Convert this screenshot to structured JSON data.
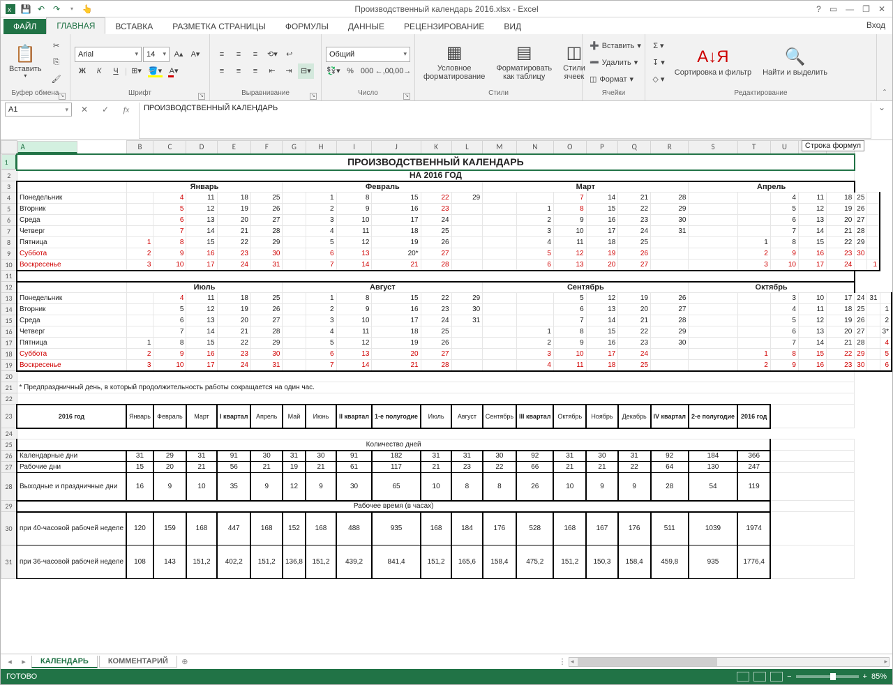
{
  "title": "Производственный календарь 2016.xlsx - Excel",
  "login": "Вход",
  "tabs": {
    "file": "ФАЙЛ",
    "list": [
      "ГЛАВНАЯ",
      "ВСТАВКА",
      "РАЗМЕТКА СТРАНИЦЫ",
      "ФОРМУЛЫ",
      "ДАННЫЕ",
      "РЕЦЕНЗИРОВАНИЕ",
      "ВИД"
    ],
    "active": 0
  },
  "ribbon": {
    "clipboard": {
      "label": "Буфер обмена",
      "paste": "Вставить"
    },
    "font": {
      "label": "Шрифт",
      "name": "Arial",
      "size": "14"
    },
    "align": {
      "label": "Выравнивание"
    },
    "number": {
      "label": "Число",
      "format": "Общий"
    },
    "styles": {
      "label": "Стили",
      "cond": "Условное форматирование",
      "fmt": "Форматировать как таблицу",
      "cell": "Стили ячеек"
    },
    "cells": {
      "label": "Ячейки",
      "ins": "Вставить",
      "del": "Удалить",
      "fmt": "Формат"
    },
    "edit": {
      "label": "Редактирование",
      "sort": "Сортировка и фильтр",
      "find": "Найти и выделить"
    }
  },
  "namebox": "A1",
  "formula": "ПРОИЗВОДСТВЕННЫЙ КАЛЕНДАРЬ",
  "tooltip": "Строка формул",
  "cols": [
    "A",
    "B",
    "C",
    "D",
    "E",
    "F",
    "G",
    "H",
    "I",
    "J",
    "K",
    "L",
    "M",
    "N",
    "O",
    "P",
    "Q",
    "R",
    "S",
    "T",
    "U",
    "V",
    "W"
  ],
  "sheet": {
    "title1": "ПРОИЗВОДСТВЕННЫЙ КАЛЕНДАРЬ",
    "title2": "НА 2016 ГОД",
    "months1": [
      "Январь",
      "Февраль",
      "Март",
      "Апрель"
    ],
    "months2": [
      "Июль",
      "Август",
      "Сентябрь",
      "Октябрь"
    ],
    "days": [
      "Понедельник",
      "Вторник",
      "Среда",
      "Четверг",
      "Пятница",
      "Суббота",
      "Воскресенье"
    ],
    "block1": {
      "jan": [
        [
          "",
          "4",
          "11",
          "18",
          "25"
        ],
        [
          "",
          "5",
          "12",
          "19",
          "26"
        ],
        [
          "",
          "6",
          "13",
          "20",
          "27"
        ],
        [
          "",
          "7",
          "14",
          "21",
          "28"
        ],
        [
          "1",
          "8",
          "15",
          "22",
          "29"
        ],
        [
          "2",
          "9",
          "16",
          "23",
          "30"
        ],
        [
          "3",
          "10",
          "17",
          "24",
          "31"
        ]
      ],
      "jan_red": [
        [
          0,
          1,
          0,
          0,
          0
        ],
        [
          0,
          1,
          0,
          0,
          0
        ],
        [
          0,
          1,
          0,
          0,
          0
        ],
        [
          0,
          1,
          0,
          0,
          0
        ],
        [
          1,
          1,
          0,
          0,
          0
        ],
        [
          1,
          1,
          1,
          1,
          1
        ],
        [
          1,
          1,
          1,
          1,
          1
        ]
      ],
      "feb": [
        [
          "1",
          "8",
          "15",
          "22",
          "29"
        ],
        [
          "2",
          "9",
          "16",
          "23",
          ""
        ],
        [
          "3",
          "10",
          "17",
          "24",
          ""
        ],
        [
          "4",
          "11",
          "18",
          "25",
          ""
        ],
        [
          "5",
          "12",
          "19",
          "26",
          ""
        ],
        [
          "6",
          "13",
          "20*",
          "27",
          ""
        ],
        [
          "7",
          "14",
          "21",
          "28",
          ""
        ]
      ],
      "feb_red": [
        [
          0,
          0,
          0,
          1,
          0
        ],
        [
          0,
          0,
          0,
          1,
          0
        ],
        [
          0,
          0,
          0,
          0,
          0
        ],
        [
          0,
          0,
          0,
          0,
          0
        ],
        [
          0,
          0,
          0,
          0,
          0
        ],
        [
          1,
          1,
          0,
          1,
          0
        ],
        [
          1,
          1,
          1,
          1,
          0
        ]
      ],
      "mar": [
        [
          "",
          "7",
          "14",
          "21",
          "28"
        ],
        [
          "1",
          "8",
          "15",
          "22",
          "29"
        ],
        [
          "2",
          "9",
          "16",
          "23",
          "30"
        ],
        [
          "3",
          "10",
          "17",
          "24",
          "31"
        ],
        [
          "4",
          "11",
          "18",
          "25",
          ""
        ],
        [
          "5",
          "12",
          "19",
          "26",
          ""
        ],
        [
          "6",
          "13",
          "20",
          "27",
          ""
        ]
      ],
      "mar_red": [
        [
          0,
          1,
          0,
          0,
          0
        ],
        [
          0,
          1,
          0,
          0,
          0
        ],
        [
          0,
          0,
          0,
          0,
          0
        ],
        [
          0,
          0,
          0,
          0,
          0
        ],
        [
          0,
          0,
          0,
          0,
          0
        ],
        [
          1,
          1,
          1,
          1,
          0
        ],
        [
          1,
          1,
          1,
          1,
          0
        ]
      ],
      "apr": [
        [
          "",
          "4",
          "11",
          "18",
          "25",
          ""
        ],
        [
          "",
          "5",
          "12",
          "19",
          "26",
          ""
        ],
        [
          "",
          "6",
          "13",
          "20",
          "27",
          ""
        ],
        [
          "",
          "7",
          "14",
          "21",
          "28",
          ""
        ],
        [
          "1",
          "8",
          "15",
          "22",
          "29",
          ""
        ],
        [
          "2",
          "9",
          "16",
          "23",
          "30",
          ""
        ],
        [
          "3",
          "10",
          "17",
          "24",
          "",
          "1"
        ]
      ],
      "apr_red": [
        [
          0,
          0,
          0,
          0,
          0,
          0
        ],
        [
          0,
          0,
          0,
          0,
          0,
          0
        ],
        [
          0,
          0,
          0,
          0,
          0,
          0
        ],
        [
          0,
          0,
          0,
          0,
          0,
          0
        ],
        [
          0,
          0,
          0,
          0,
          0,
          0
        ],
        [
          1,
          1,
          1,
          1,
          1,
          0
        ],
        [
          1,
          1,
          1,
          1,
          0,
          1
        ]
      ]
    },
    "block2": {
      "jul": [
        [
          "",
          "4",
          "11",
          "18",
          "25"
        ],
        [
          "",
          "5",
          "12",
          "19",
          "26"
        ],
        [
          "",
          "6",
          "13",
          "20",
          "27"
        ],
        [
          "",
          "7",
          "14",
          "21",
          "28"
        ],
        [
          "1",
          "8",
          "15",
          "22",
          "29"
        ],
        [
          "2",
          "9",
          "16",
          "23",
          "30"
        ],
        [
          "3",
          "10",
          "17",
          "24",
          "31"
        ]
      ],
      "jul_red": [
        [
          0,
          1,
          0,
          0,
          0
        ],
        [
          0,
          0,
          0,
          0,
          0
        ],
        [
          0,
          0,
          0,
          0,
          0
        ],
        [
          0,
          0,
          0,
          0,
          0
        ],
        [
          0,
          0,
          0,
          0,
          0
        ],
        [
          1,
          1,
          1,
          1,
          1
        ],
        [
          1,
          1,
          1,
          1,
          1
        ]
      ],
      "aug": [
        [
          "1",
          "8",
          "15",
          "22",
          "29"
        ],
        [
          "2",
          "9",
          "16",
          "23",
          "30"
        ],
        [
          "3",
          "10",
          "17",
          "24",
          "31"
        ],
        [
          "4",
          "11",
          "18",
          "25",
          ""
        ],
        [
          "5",
          "12",
          "19",
          "26",
          ""
        ],
        [
          "6",
          "13",
          "20",
          "27",
          ""
        ],
        [
          "7",
          "14",
          "21",
          "28",
          ""
        ]
      ],
      "aug_red": [
        [
          0,
          0,
          0,
          0,
          0
        ],
        [
          0,
          0,
          0,
          0,
          0
        ],
        [
          0,
          0,
          0,
          0,
          0
        ],
        [
          0,
          0,
          0,
          0,
          0
        ],
        [
          0,
          0,
          0,
          0,
          0
        ],
        [
          1,
          1,
          1,
          1,
          0
        ],
        [
          1,
          1,
          1,
          1,
          0
        ]
      ],
      "sep": [
        [
          "",
          "5",
          "12",
          "19",
          "26"
        ],
        [
          "",
          "6",
          "13",
          "20",
          "27"
        ],
        [
          "",
          "7",
          "14",
          "21",
          "28"
        ],
        [
          "1",
          "8",
          "15",
          "22",
          "29"
        ],
        [
          "2",
          "9",
          "16",
          "23",
          "30"
        ],
        [
          "3",
          "10",
          "17",
          "24",
          ""
        ],
        [
          "4",
          "11",
          "18",
          "25",
          ""
        ]
      ],
      "sep_red": [
        [
          0,
          0,
          0,
          0,
          0
        ],
        [
          0,
          0,
          0,
          0,
          0
        ],
        [
          0,
          0,
          0,
          0,
          0
        ],
        [
          0,
          0,
          0,
          0,
          0
        ],
        [
          0,
          0,
          0,
          0,
          0
        ],
        [
          1,
          1,
          1,
          1,
          0
        ],
        [
          1,
          1,
          1,
          1,
          0
        ]
      ],
      "oct": [
        [
          "",
          "3",
          "10",
          "17",
          "24",
          "31",
          ""
        ],
        [
          "",
          "4",
          "11",
          "18",
          "25",
          "",
          "1"
        ],
        [
          "",
          "5",
          "12",
          "19",
          "26",
          "",
          "2"
        ],
        [
          "",
          "6",
          "13",
          "20",
          "27",
          "",
          "3*"
        ],
        [
          "",
          "7",
          "14",
          "21",
          "28",
          "",
          "4"
        ],
        [
          "1",
          "8",
          "15",
          "22",
          "29",
          "",
          "5"
        ],
        [
          "2",
          "9",
          "16",
          "23",
          "30",
          "",
          "6"
        ]
      ],
      "oct_red": [
        [
          0,
          0,
          0,
          0,
          0,
          0,
          0
        ],
        [
          0,
          0,
          0,
          0,
          0,
          0,
          0
        ],
        [
          0,
          0,
          0,
          0,
          0,
          0,
          0
        ],
        [
          0,
          0,
          0,
          0,
          0,
          0,
          0
        ],
        [
          0,
          0,
          0,
          0,
          0,
          0,
          1
        ],
        [
          1,
          1,
          1,
          1,
          1,
          0,
          1
        ],
        [
          1,
          1,
          1,
          1,
          1,
          0,
          1
        ]
      ]
    },
    "note": "* Предпраздничный день, в который продолжительность работы сокращается на один час.",
    "table": {
      "headers": [
        "2016 год",
        "Январь",
        "Февраль",
        "Март",
        "I квартал",
        "Апрель",
        "Май",
        "Июнь",
        "II квартал",
        "1-е полугодие",
        "Июль",
        "Август",
        "Сентябрь",
        "III квартал",
        "Октябрь",
        "Ноябрь",
        "Декабрь",
        "IV квартал",
        "2-е полугодие",
        "2016 год"
      ],
      "sec1": "Количество дней",
      "rows1": [
        {
          "l": "Календарные дни",
          "v": [
            "31",
            "29",
            "31",
            "91",
            "30",
            "31",
            "30",
            "91",
            "182",
            "31",
            "31",
            "30",
            "92",
            "31",
            "30",
            "31",
            "92",
            "184",
            "366"
          ]
        },
        {
          "l": "Рабочие дни",
          "v": [
            "15",
            "20",
            "21",
            "56",
            "21",
            "19",
            "21",
            "61",
            "117",
            "21",
            "23",
            "22",
            "66",
            "21",
            "21",
            "22",
            "64",
            "130",
            "247"
          ]
        },
        {
          "l": "Выходные и праздничные дни",
          "v": [
            "16",
            "9",
            "10",
            "35",
            "9",
            "12",
            "9",
            "30",
            "65",
            "10",
            "8",
            "8",
            "26",
            "10",
            "9",
            "9",
            "28",
            "54",
            "119"
          ]
        }
      ],
      "sec2": "Рабочее время (в часах)",
      "rows2": [
        {
          "l": "при 40-часовой рабочей неделе",
          "v": [
            "120",
            "159",
            "168",
            "447",
            "168",
            "152",
            "168",
            "488",
            "935",
            "168",
            "184",
            "176",
            "528",
            "168",
            "167",
            "176",
            "511",
            "1039",
            "1974"
          ]
        },
        {
          "l": "при 36-часовой рабочей неделе",
          "v": [
            "108",
            "143",
            "151,2",
            "402,2",
            "151,2",
            "136,8",
            "151,2",
            "439,2",
            "841,4",
            "151,2",
            "165,6",
            "158,4",
            "475,2",
            "151,2",
            "150,3",
            "158,4",
            "459,8",
            "935",
            "1776,4"
          ]
        }
      ]
    }
  },
  "sheettabs": {
    "tabs": [
      "КАЛЕНДАРЬ",
      "КОММЕНТАРИЙ"
    ],
    "active": 0
  },
  "status": {
    "ready": "ГОТОВО",
    "zoom": "85%"
  }
}
